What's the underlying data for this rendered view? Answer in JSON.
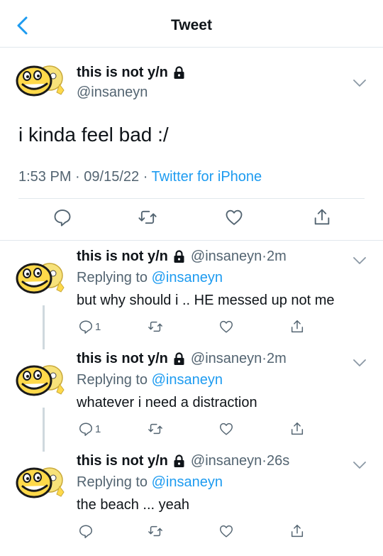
{
  "header": {
    "title": "Tweet",
    "back_icon": "chevron-left-icon"
  },
  "accent_color": "#1d9bf0",
  "main_tweet": {
    "name": "this is not y/n",
    "handle": "@insaneyn",
    "text": "i kinda feel bad :/",
    "time": "1:53 PM",
    "date": "09/15/22",
    "source": "Twitter for iPhone",
    "actions": [
      "reply-icon",
      "retweet-icon",
      "like-icon",
      "share-icon"
    ]
  },
  "replies": [
    {
      "name": "this is not y/n",
      "handle": "@insaneyn",
      "time": "2m",
      "replying_label": "Replying to",
      "replying_to": "@insaneyn",
      "text": "but why should i .. HE messed up not me",
      "reply_count": "1"
    },
    {
      "name": "this is not y/n",
      "handle": "@insaneyn",
      "time": "2m",
      "replying_label": "Replying to",
      "replying_to": "@insaneyn",
      "text": "whatever i need a distraction",
      "reply_count": "1"
    },
    {
      "name": "this is not y/n",
      "handle": "@insaneyn",
      "time": "26s",
      "replying_label": "Replying to",
      "replying_to": "@insaneyn",
      "text": "the beach ... yeah",
      "reply_count": ""
    }
  ]
}
